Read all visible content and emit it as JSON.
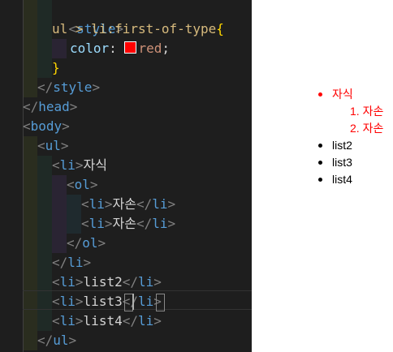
{
  "code": {
    "style_open": "<style>",
    "selector": "ul > li:first-of-type",
    "brace_open": "{",
    "property": "color",
    "colon": ": ",
    "value": "red",
    "semicolon": ";",
    "brace_close": "}",
    "style_close": "</style>",
    "head_close": "</head>",
    "body_open": "<body>",
    "ul_open": "<ul>",
    "li_open": "<li>",
    "li_close": "</li>",
    "ol_open": "<ol>",
    "ol_close": "</ol>",
    "ul_close": "</ul>",
    "text_child": "자식",
    "text_grandchild": "자손",
    "text_list2": "list2",
    "text_list3": "list3",
    "text_list4": "list4"
  },
  "colors": {
    "editor_bg": "#1e1e1e",
    "tag_bracket": "#808080",
    "tag_name": "#569cd6",
    "selector": "#d7ba7d",
    "property": "#9cdcfe",
    "value": "#ce9178",
    "brace": "#ffd700",
    "highlight_red": "#ff0000"
  },
  "preview": {
    "first_item": "자식",
    "nested_numbers": [
      "1.",
      "2."
    ],
    "nested_items": [
      "자손",
      "자손"
    ],
    "items": [
      "list2",
      "list3",
      "list4"
    ]
  }
}
